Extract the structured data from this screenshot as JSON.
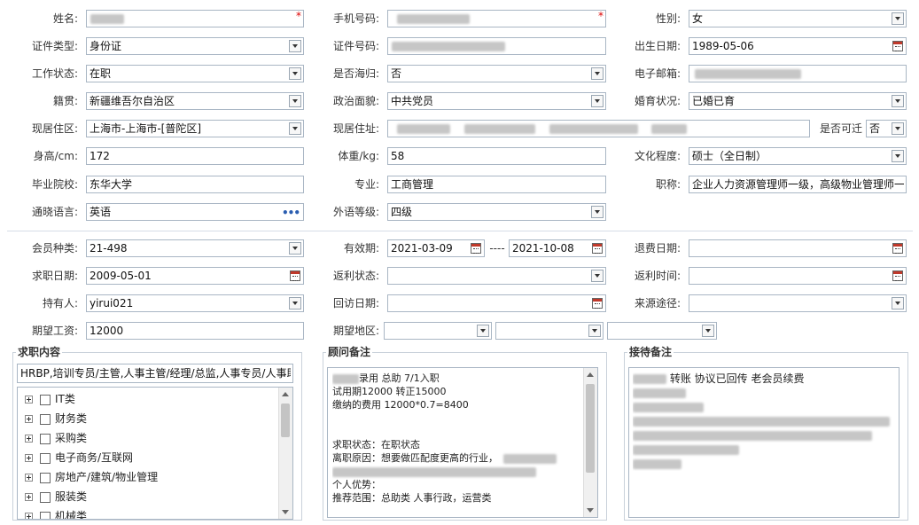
{
  "required_mark": "*",
  "personal": {
    "name_label": "姓名:",
    "phone_label": "手机号码:",
    "gender_label": "性别:",
    "gender_value": "女",
    "idtype_label": "证件类型:",
    "idtype_value": "身份证",
    "idno_label": "证件号码:",
    "birth_label": "出生日期:",
    "birth_value": "1989-05-06",
    "workstatus_label": "工作状态:",
    "workstatus_value": "在职",
    "returnee_label": "是否海归:",
    "returnee_value": "否",
    "email_label": "电子邮箱:",
    "native_label": "籍贯:",
    "native_value": "新疆维吾尔自治区",
    "political_label": "政治面貌:",
    "political_value": "中共党员",
    "marital_label": "婚育状况:",
    "marital_value": "已婚已育",
    "residence_label": "现居住区:",
    "residence_value": "上海市-上海市-[普陀区]",
    "address_label": "现居住址:",
    "relocate_label": "是否可迁",
    "relocate_value": "否",
    "height_label": "身高/cm:",
    "height_value": "172",
    "weight_label": "体重/kg:",
    "weight_value": "58",
    "education_label": "文化程度:",
    "education_value": "硕士（全日制）",
    "school_label": "毕业院校:",
    "school_value": "东华大学",
    "major_label": "专业:",
    "major_value": "工商管理",
    "title_label": "职称:",
    "title_value": "企业人力资源管理师一级，高级物业管理师一",
    "language_label": "通晓语言:",
    "language_value": "英语",
    "language_more": "•••",
    "langlevel_label": "外语等级:",
    "langlevel_value": "四级"
  },
  "membership": {
    "type_label": "会员种类:",
    "type_value": "21-498",
    "valid_label": "有效期:",
    "valid_from": "2021-03-09",
    "valid_sep": "----",
    "valid_to": "2021-10-08",
    "refund_label": "退费日期:",
    "jobdate_label": "求职日期:",
    "jobdate_value": "2009-05-01",
    "rebate_status_label": "返利状态:",
    "rebate_time_label": "返利时间:",
    "holder_label": "持有人:",
    "holder_value": "yirui021",
    "visit_label": "回访日期:",
    "source_label": "来源途径:",
    "salary_label": "期望工资:",
    "salary_value": "12000",
    "area_label": "期望地区:"
  },
  "job_panel": {
    "title": "求职内容",
    "summary": "HRBP,培训专员/主管,人事主管/经理/总监,人事专员/人事助",
    "items": [
      "IT类",
      "财务类",
      "采购类",
      "电子商务/互联网",
      "房地产/建筑/物业管理",
      "服装类",
      "机械类"
    ]
  },
  "advisor_panel": {
    "title": "顾问备注",
    "line1_text": "录用  总助  7/1入职",
    "line2": "试用期12000   转正15000",
    "line3": "缴纳的费用  12000*0.7=8400",
    "line4": "求职状态：在职状态",
    "line5": "离职原因：想要做匹配度更高的行业，",
    "line6": "个人优势：",
    "line7": "推荐范围：总助类 人事行政，运营类"
  },
  "reception_panel": {
    "title": "接待备注",
    "line1_text": "转账  协议已回传    老会员续费"
  }
}
